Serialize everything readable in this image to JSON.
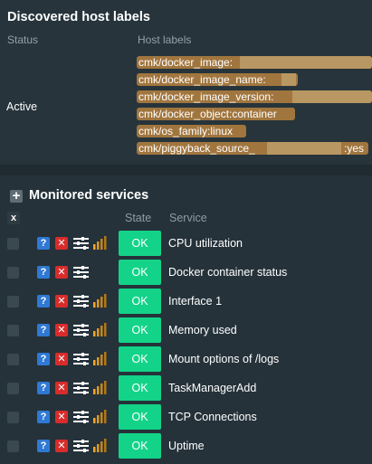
{
  "discovered": {
    "title": "Discovered host labels",
    "col_status": "Status",
    "col_host_labels": "Host labels",
    "status_value": "Active",
    "labels": [
      "cmk/docker_image:",
      "cmk/docker_image_name:",
      "cmk/docker_image_version:",
      "cmk/docker_object:container",
      "cmk/os_family:linux",
      "cmk/piggyback_source_"
    ],
    "last_label_value": ":yes"
  },
  "monitored": {
    "title": "Monitored services",
    "add_symbol": "+",
    "toggle_all": "x",
    "col_state": "State",
    "col_service": "Service",
    "help_symbol": "?",
    "delete_symbol": "✕",
    "services": [
      {
        "state": "OK",
        "name": "CPU utilization",
        "has_perf": true
      },
      {
        "state": "OK",
        "name": "Docker container status",
        "has_perf": false
      },
      {
        "state": "OK",
        "name": "Interface 1",
        "has_perf": true
      },
      {
        "state": "OK",
        "name": "Memory used",
        "has_perf": true
      },
      {
        "state": "OK",
        "name": "Mount options of /logs",
        "has_perf": true
      },
      {
        "state": "OK",
        "name": "TaskManagerAdd",
        "has_perf": true
      },
      {
        "state": "OK",
        "name": "TCP Connections",
        "has_perf": true
      },
      {
        "state": "OK",
        "name": "Uptime",
        "has_perf": true
      }
    ]
  },
  "colors": {
    "state_ok": "#13d389",
    "help_icon": "#2f79d5",
    "delete_icon": "#d82c2c",
    "host_label_tag": "#a1763e",
    "perf_bars": [
      "#f5a623",
      "#e09a1e",
      "#c7861a",
      "#b07716"
    ]
  },
  "icons": {
    "add": "plus-icon",
    "toggle": "x-icon",
    "help": "help-icon",
    "delete": "delete-icon",
    "menu": "menu-icon",
    "perf": "perfometer-icon"
  }
}
